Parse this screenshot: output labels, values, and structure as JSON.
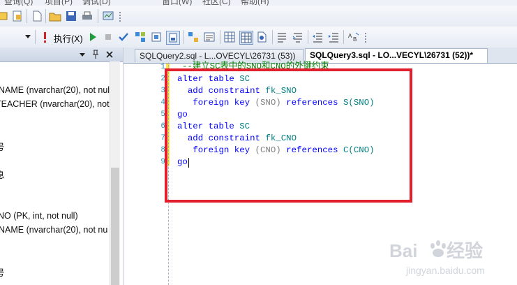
{
  "menubar": {
    "items": [
      "查询(Q)",
      "项目(P)",
      "调试(D)",
      "窗口(W)",
      "社区(C)",
      "帮助(H)"
    ]
  },
  "toolbar2": {
    "execute_label": "执行(X)"
  },
  "tabs": [
    {
      "label": "SQLQuery2.sql - L...OVECYL\\26731 (53))",
      "active": false
    },
    {
      "label": "SQLQuery3.sql - LO...VECYL\\26731 (52))*",
      "active": true
    }
  ],
  "left_panel": {
    "rows": [
      "NAME (nvarchar(20), not nul",
      "TEACHER (nvarchar(20), not",
      "号",
      "息",
      "NO (PK, int, not null)",
      "NAME (nvarchar(20), not nu",
      "号"
    ]
  },
  "editor": {
    "line_numbers": [
      "1",
      "2",
      "3",
      "4",
      "5",
      "6",
      "7",
      "8",
      "9"
    ],
    "comment": "--建立SC表中的SNO和CNO的外键约束",
    "lines": {
      "alter1_kw": "alter table",
      "alter1_tbl": "SC",
      "add1_kw": "add constraint",
      "add1_name": "fk_SNO",
      "fk1_kw": "foreign key",
      "fk1_paren": "(SNO)",
      "fk1_ref": "references",
      "fk1_target": "S(SNO)",
      "go1": "go",
      "alter2_kw": "alter table",
      "alter2_tbl": "SC",
      "add2_kw": "add constraint",
      "add2_name": "fk_CNO",
      "fk2_kw": "foreign key",
      "fk2_paren": "(CNO)",
      "fk2_ref": "references",
      "fk2_target": "C(CNO)",
      "go2": "go"
    }
  },
  "colors": {
    "keyword": "#0000ff",
    "identifier": "#008080",
    "comment": "#008000",
    "annotation_box": "#e21f2c"
  },
  "watermark": {
    "brand": "Baidu经验",
    "url": "jingyan.baidu.com"
  }
}
